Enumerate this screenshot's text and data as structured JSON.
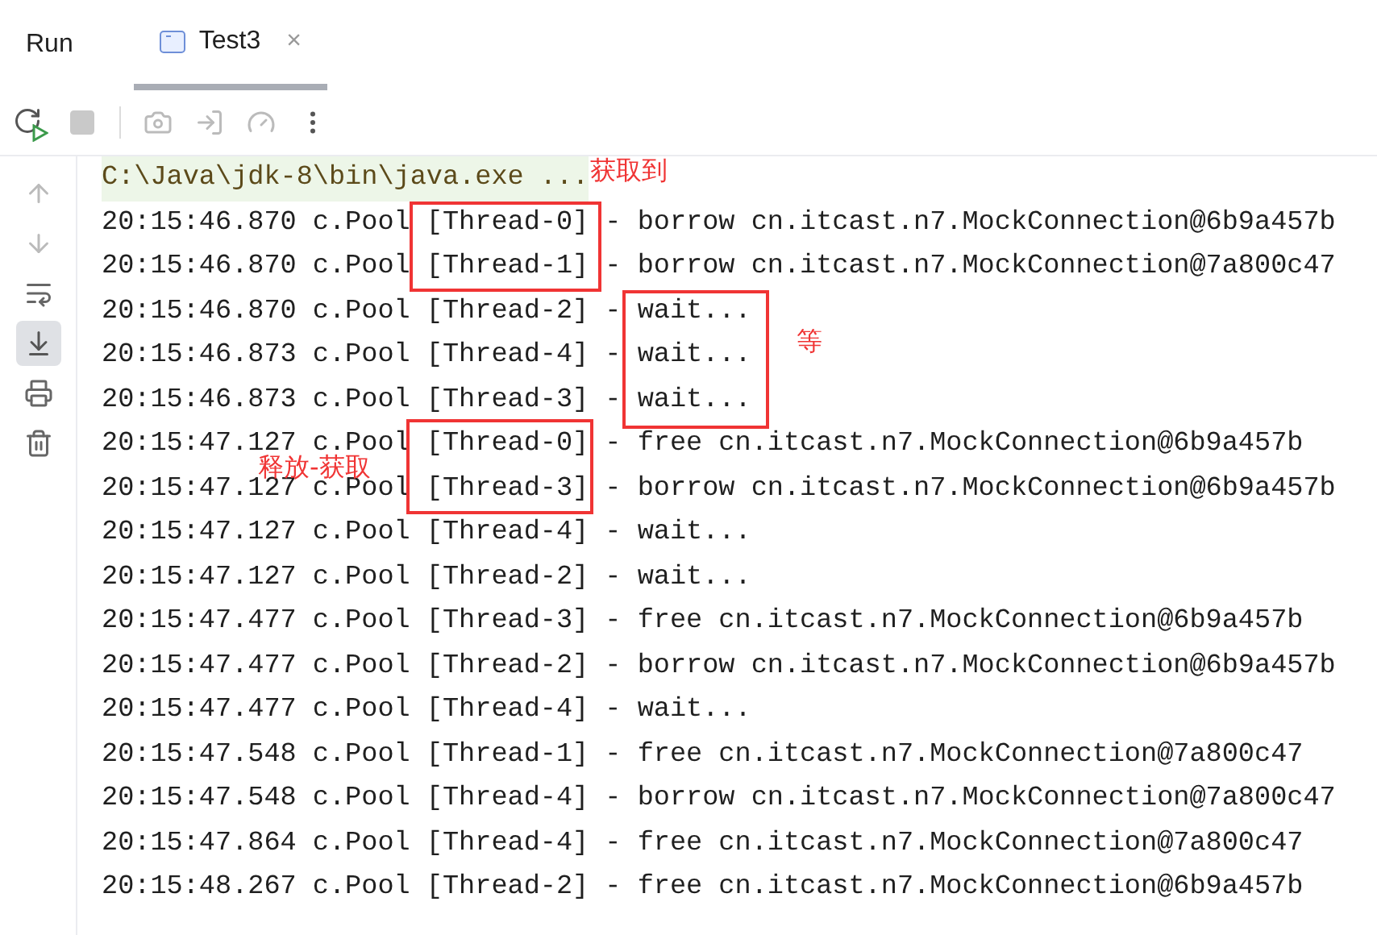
{
  "tool_window": {
    "title": "Run",
    "tabs": [
      {
        "label": "Test3",
        "selected": true,
        "close": "×"
      }
    ]
  },
  "gutter": {
    "scroll_to_end_on": true
  },
  "console": {
    "command": "C:\\Java\\jdk-8\\bin\\java.exe ...",
    "lines": [
      "20:15:46.870 c.Pool [Thread-0] - borrow cn.itcast.n7.MockConnection@6b9a457b",
      "20:15:46.870 c.Pool [Thread-1] - borrow cn.itcast.n7.MockConnection@7a800c47",
      "20:15:46.870 c.Pool [Thread-2] - wait...",
      "20:15:46.873 c.Pool [Thread-4] - wait...",
      "20:15:46.873 c.Pool [Thread-3] - wait...",
      "20:15:47.127 c.Pool [Thread-0] - free cn.itcast.n7.MockConnection@6b9a457b",
      "20:15:47.127 c.Pool [Thread-3] - borrow cn.itcast.n7.MockConnection@6b9a457b",
      "20:15:47.127 c.Pool [Thread-4] - wait...",
      "20:15:47.127 c.Pool [Thread-2] - wait...",
      "20:15:47.477 c.Pool [Thread-3] - free cn.itcast.n7.MockConnection@6b9a457b",
      "20:15:47.477 c.Pool [Thread-2] - borrow cn.itcast.n7.MockConnection@6b9a457b",
      "20:15:47.477 c.Pool [Thread-4] - wait...",
      "20:15:47.548 c.Pool [Thread-1] - free cn.itcast.n7.MockConnection@7a800c47",
      "20:15:47.548 c.Pool [Thread-4] - borrow cn.itcast.n7.MockConnection@7a800c47",
      "20:15:47.864 c.Pool [Thread-4] - free cn.itcast.n7.MockConnection@7a800c47",
      "20:15:48.267 c.Pool [Thread-2] - free cn.itcast.n7.MockConnection@6b9a457b"
    ]
  },
  "annotations": [
    {
      "label": "获取到"
    },
    {
      "label": "等"
    },
    {
      "label": "释放-获取"
    }
  ]
}
